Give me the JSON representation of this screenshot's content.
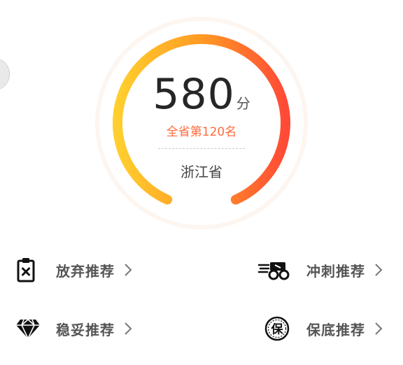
{
  "score": {
    "value": "580",
    "unit": "分",
    "rank_text": "全省第120名",
    "province": "浙江省"
  },
  "gauge": {
    "gradient_colors": [
      "#ffcf2e",
      "#ff9a24",
      "#ff4a36"
    ]
  },
  "menu": {
    "items": [
      {
        "label": "放弃推荐",
        "icon": "clipboard-x-icon"
      },
      {
        "label": "冲刺推荐",
        "icon": "sprint-runner-icon"
      },
      {
        "label": "稳妥推荐",
        "icon": "diamond-icon"
      },
      {
        "label": "保底推荐",
        "icon": "bao-stamp-icon"
      }
    ],
    "icon_glyph_bao": "保"
  }
}
